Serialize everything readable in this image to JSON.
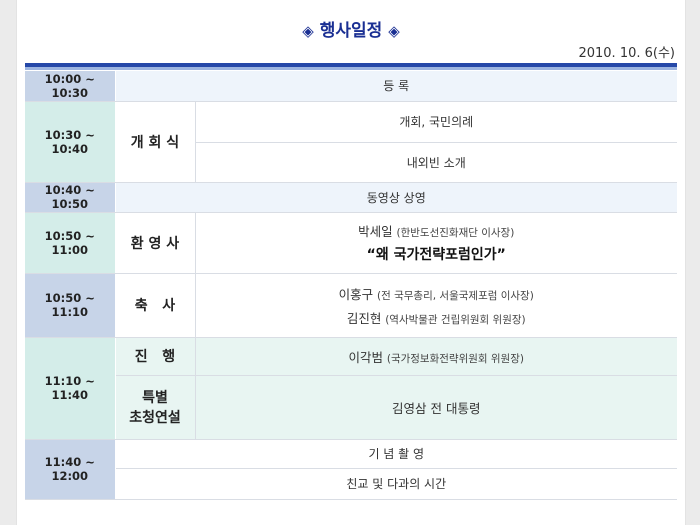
{
  "header": {
    "title": "행사일정",
    "diamond_left": "◈",
    "diamond_right": "◈",
    "date": "2010. 10. 6(수)"
  },
  "schedule": {
    "r1": {
      "time": "10:00 ~ 10:30",
      "event": "등 록"
    },
    "r2": {
      "time": "10:30 ~ 10:40",
      "category": "개 회 식",
      "item1": "개회, 국민의례",
      "item2": "내외빈 소개"
    },
    "r3": {
      "time": "10:40 ~ 10:50",
      "event": "동영상 상영"
    },
    "r4": {
      "time": "10:50 ~ 11:00",
      "category": "환 영 사",
      "speaker": "박세일",
      "speaker_role": "(한반도선진화재단 이사장)",
      "quote": "“왜 국가전략포럼인가”"
    },
    "r5": {
      "time": "10:50 ~ 11:10",
      "category": "축   사",
      "speaker1": "이홍구",
      "speaker1_role": "(전 국무총리, 서울국제포럼 이사장)",
      "speaker2": "김진현",
      "speaker2_role": "(역사박물관 건립위원회 위원장)"
    },
    "r6": {
      "time": "11:10 ~ 11:40",
      "category1": "진   행",
      "item1_name": "이각범",
      "item1_role": "(국가정보화전략위원회 위원장)",
      "category2_line1": "특별",
      "category2_line2": "초청연설",
      "item2": "김영삼 전 대통령"
    },
    "r7": {
      "time": "11:40 ~ 12:00",
      "item1": "기 념 촬 영",
      "item2": "친교 및 다과의 시간"
    }
  },
  "colors": {
    "accent": "#2548a8",
    "time_blue": "#c7d4e8",
    "time_teal": "#d4ede9"
  }
}
